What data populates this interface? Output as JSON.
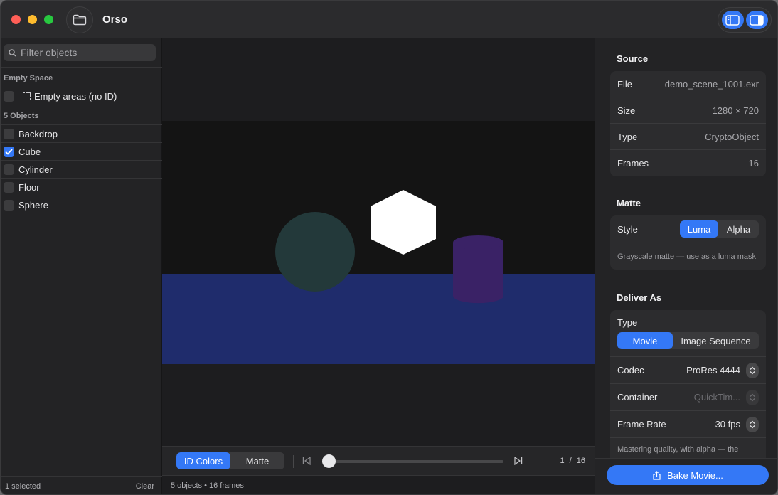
{
  "app": {
    "title": "Orso"
  },
  "sidebar": {
    "filter_placeholder": "Filter objects",
    "empty_section": "Empty Space",
    "empty_item": "Empty areas (no ID)",
    "objects_section": "5 Objects",
    "objects": [
      {
        "label": "Backdrop",
        "checked": false
      },
      {
        "label": "Cube",
        "checked": true
      },
      {
        "label": "Cylinder",
        "checked": false
      },
      {
        "label": "Floor",
        "checked": false
      },
      {
        "label": "Sphere",
        "checked": false
      }
    ],
    "footer_selected": "1 selected",
    "footer_clear": "Clear"
  },
  "viewer": {
    "mode_id_colors": "ID Colors",
    "mode_matte": "Matte",
    "active_mode": "ID Colors",
    "current_frame": "1",
    "frame_separator": "/",
    "total_frames": "16",
    "playhead_fraction": 0.0,
    "footer": "5 objects • 16 frames",
    "scene_colors": {
      "backdrop": "#141414",
      "floor": "#1f2c6c",
      "sphere": "#23393a",
      "cube": "#ffffff",
      "cylinder": "#3a2266"
    }
  },
  "inspector": {
    "source_title": "Source",
    "source": [
      {
        "key": "File",
        "value": "demo_scene_1001.exr"
      },
      {
        "key": "Size",
        "value": "1280 × 720"
      },
      {
        "key": "Type",
        "value": "CryptoObject"
      },
      {
        "key": "Frames",
        "value": "16"
      }
    ],
    "matte_title": "Matte",
    "matte_style_label": "Style",
    "matte_luma": "Luma",
    "matte_alpha": "Alpha",
    "matte_active": "Luma",
    "matte_note": "Grayscale matte — use as a luma mask",
    "deliver_title": "Deliver As",
    "deliver_type_label": "Type",
    "deliver_movie": "Movie",
    "deliver_sequence": "Image Sequence",
    "codec_label": "Codec",
    "codec_value": "ProRes 4444",
    "container_label": "Container",
    "container_value": "QuickTim...",
    "framerate_label": "Frame Rate",
    "framerate_value": "30 fps",
    "deliver_note": "Mastering quality, with alpha — the",
    "bake_label": "Bake Movie..."
  },
  "colors": {
    "accent": "#3478f6"
  }
}
